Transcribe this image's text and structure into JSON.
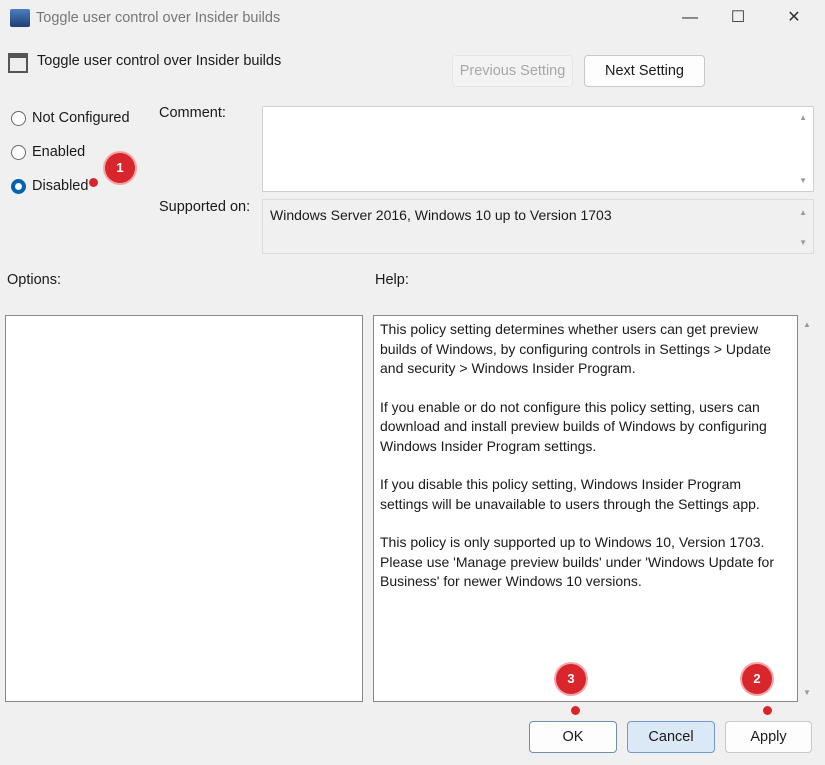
{
  "window": {
    "title": "Toggle user control over Insider builds",
    "minimize": "—",
    "maximize": "☐",
    "close": "✕"
  },
  "header": {
    "policy_name": "Toggle user control over Insider builds",
    "previous_label": "Previous Setting",
    "next_label": "Next Setting"
  },
  "state": {
    "options": [
      {
        "label": "Not Configured",
        "selected": false
      },
      {
        "label": "Enabled",
        "selected": false
      },
      {
        "label": "Disabled",
        "selected": true
      }
    ]
  },
  "comment": {
    "label": "Comment:",
    "value": ""
  },
  "supported": {
    "label": "Supported on:",
    "value": "Windows Server 2016, Windows 10 up to Version 1703"
  },
  "options_label": "Options:",
  "help": {
    "label": "Help:",
    "paragraphs": [
      "This policy setting determines whether users can get preview builds of Windows, by configuring controls in Settings > Update and security > Windows Insider Program.",
      "If you enable or do not configure this policy setting, users can download and install preview builds of Windows by configuring Windows Insider Program settings.",
      "If you disable this policy setting, Windows Insider Program settings will be unavailable to users through the Settings app.",
      "This policy is only supported up to Windows 10, Version 1703. Please use 'Manage preview builds' under 'Windows Update for Business' for newer Windows 10 versions."
    ]
  },
  "footer": {
    "ok": "OK",
    "cancel": "Cancel",
    "apply": "Apply"
  },
  "annotations": [
    "1",
    "2",
    "3"
  ],
  "colors": {
    "accent": "#0063b1",
    "badge": "#d8262c"
  }
}
